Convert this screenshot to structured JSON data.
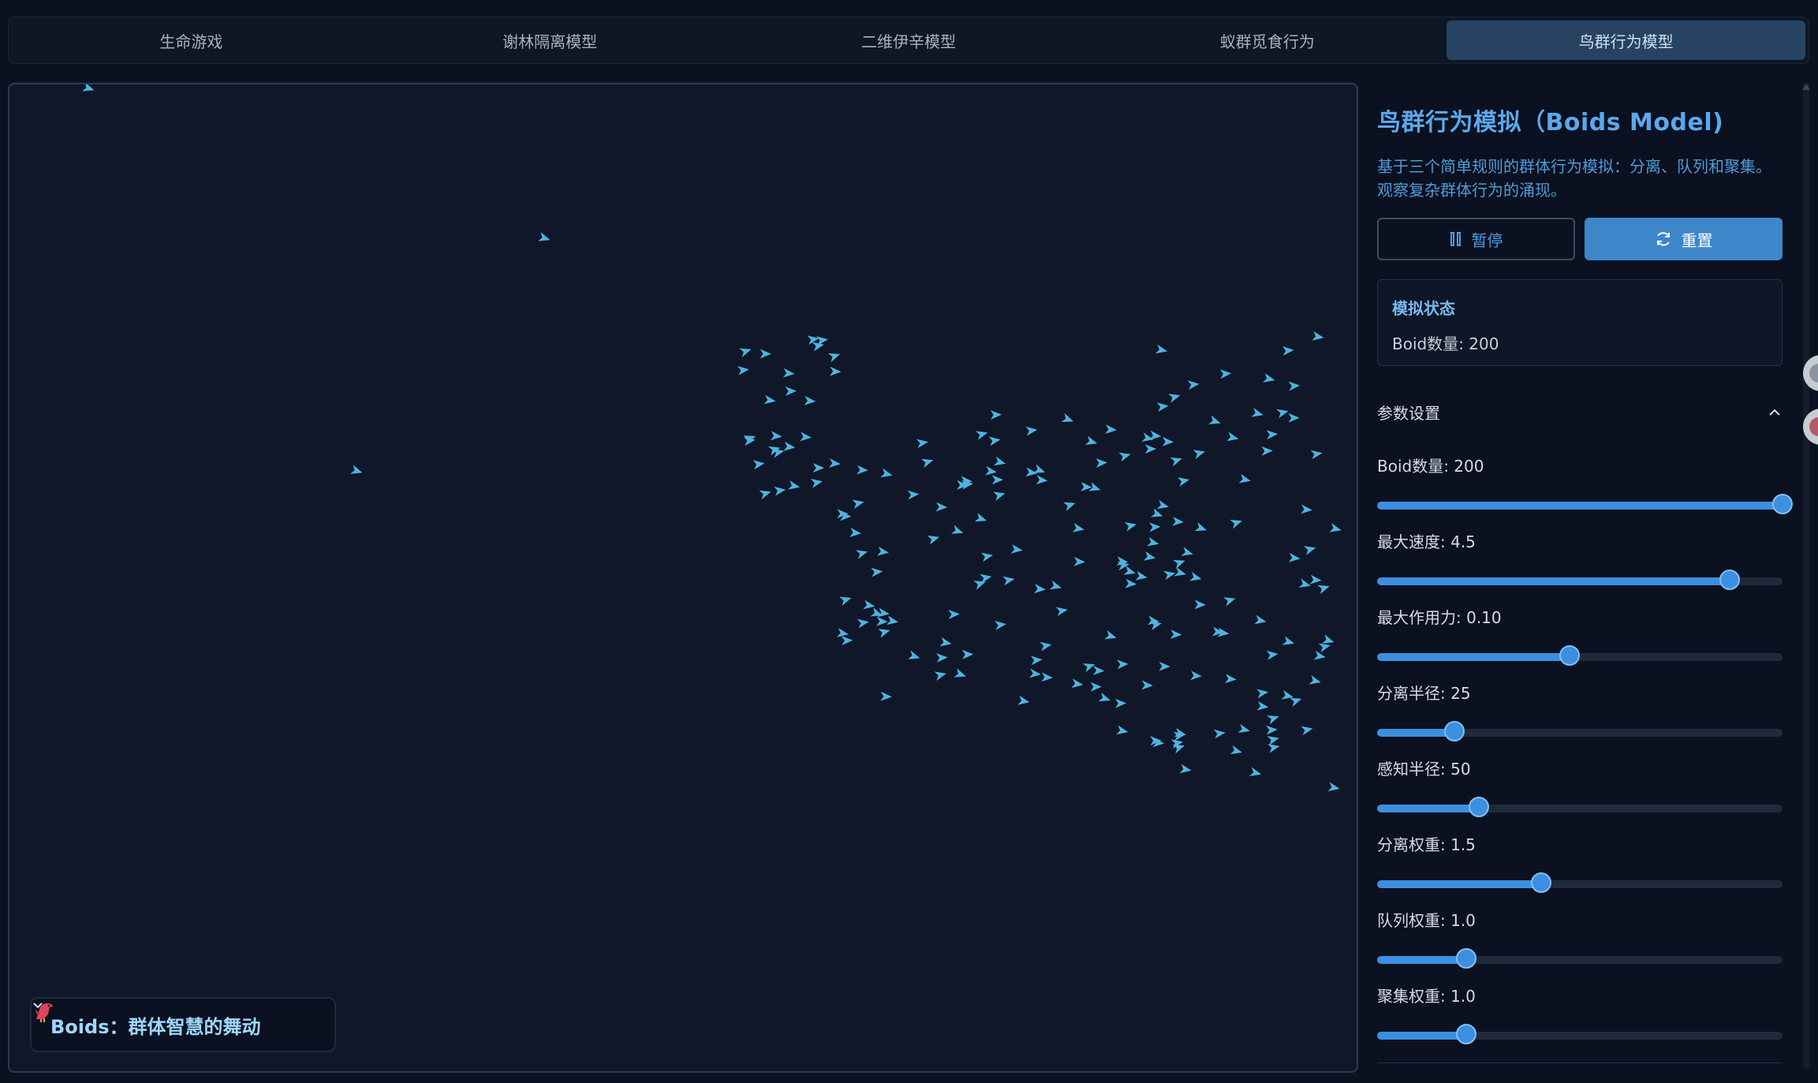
{
  "tabs": [
    {
      "label": "生命游戏",
      "active": false
    },
    {
      "label": "谢林隔离模型",
      "active": false
    },
    {
      "label": "二维伊辛模型",
      "active": false
    },
    {
      "label": "蚁群觅食行为",
      "active": false
    },
    {
      "label": "鸟群行为模型",
      "active": true
    }
  ],
  "canvas": {
    "info_chip": {
      "label": "Boids：群体智慧的舞动",
      "icon": "bird-icon",
      "expand_icon": "chevron-down-icon"
    },
    "boid_color": "#4fb3e0"
  },
  "panel": {
    "title": "鸟群行为模拟（Boids Model)",
    "description": "基于三个简单规则的群体行为模拟：分离、队列和聚集。观察复杂群体行为的涌现。",
    "pause_label": "暂停",
    "reset_label": "重置",
    "status": {
      "title": "模拟状态",
      "count_text": "Boid数量: 200"
    },
    "params_title": "参数设置",
    "sliders": [
      {
        "label": "Boid数量: 200",
        "fraction": 1.0
      },
      {
        "label": "最大速度: 4.5",
        "fraction": 0.87
      },
      {
        "label": "最大作用力: 0.10",
        "fraction": 0.475
      },
      {
        "label": "分离半径: 25",
        "fraction": 0.19
      },
      {
        "label": "感知半径: 50",
        "fraction": 0.25
      },
      {
        "label": "分离权重: 1.5",
        "fraction": 0.405
      },
      {
        "label": "队列权重: 1.0",
        "fraction": 0.22
      },
      {
        "label": "聚集权重: 1.0",
        "fraction": 0.22
      }
    ]
  },
  "colors": {
    "accent": "#3c8fe0",
    "title": "#5aa8ec",
    "background": "#0b1120"
  }
}
